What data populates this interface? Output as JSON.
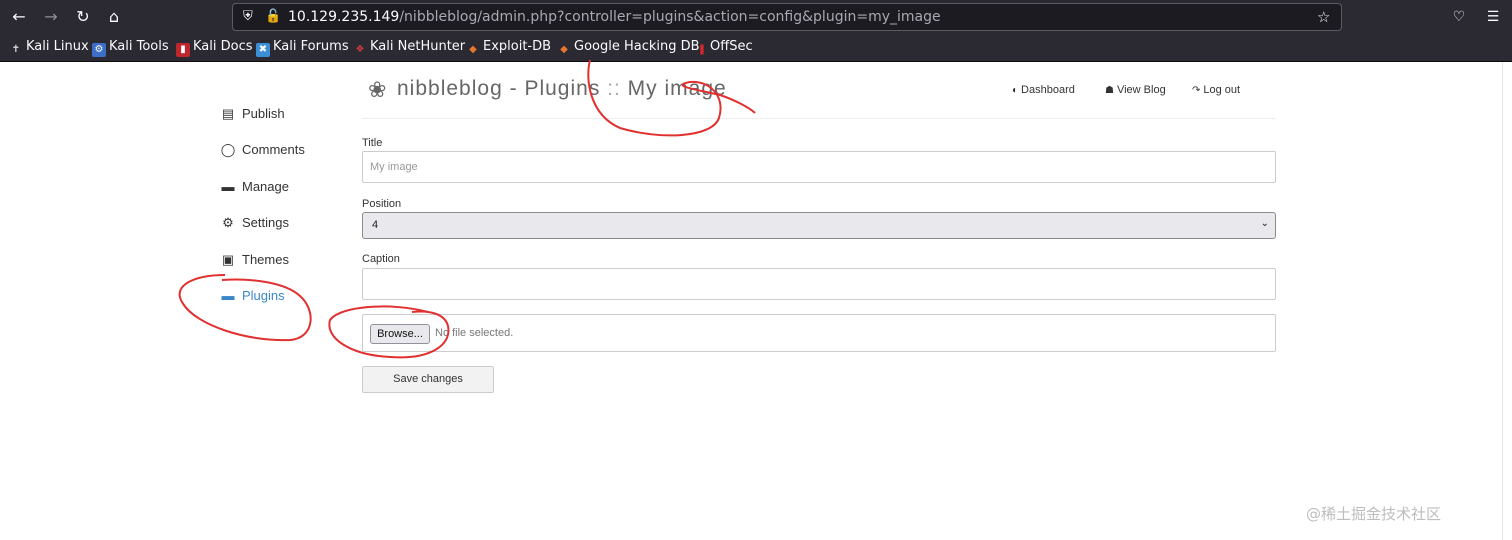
{
  "browser": {
    "url_host": "10.129.235.149",
    "url_path": "/nibbleblog/admin.php?controller=plugins&action=config&plugin=my_image",
    "bookmarks": [
      {
        "label": "Kali Linux",
        "icon": "kali-dragon-icon",
        "color": "#dddddd"
      },
      {
        "label": "Kali Tools",
        "icon": "kali-tools-icon",
        "color": "#3b6ec9"
      },
      {
        "label": "Kali Docs",
        "icon": "kali-docs-icon",
        "color": "#c0262d"
      },
      {
        "label": "Kali Forums",
        "icon": "kali-forums-icon",
        "color": "#3b8fd6"
      },
      {
        "label": "Kali NetHunter",
        "icon": "nethunter-icon",
        "color": "#d23c3c"
      },
      {
        "label": "Exploit-DB",
        "icon": "exploit-db-icon",
        "color": "#e7762d"
      },
      {
        "label": "Google Hacking DB",
        "icon": "ghdb-icon",
        "color": "#e7762d"
      },
      {
        "label": "OffSec",
        "icon": "offsec-icon",
        "color": "#d9262d"
      }
    ]
  },
  "sidebar": {
    "items": [
      {
        "label": "Publish",
        "icon": "publish-icon"
      },
      {
        "label": "Comments",
        "icon": "comment-icon"
      },
      {
        "label": "Manage",
        "icon": "folder-icon"
      },
      {
        "label": "Settings",
        "icon": "gear-icon"
      },
      {
        "label": "Themes",
        "icon": "image-icon"
      },
      {
        "label": "Plugins",
        "icon": "folder-open-icon",
        "active": true
      }
    ]
  },
  "header": {
    "brand": "nibbleblog",
    "dash": " - ",
    "section": "Plugins",
    "sep": " :: ",
    "plugin": "My image",
    "links": [
      {
        "label": "Dashboard",
        "icon": "gauge-icon"
      },
      {
        "label": "View Blog",
        "icon": "home-icon"
      },
      {
        "label": "Log out",
        "icon": "logout-icon"
      }
    ]
  },
  "form": {
    "title_label": "Title",
    "title_value": "My image",
    "position_label": "Position",
    "position_value": "4",
    "caption_label": "Caption",
    "caption_value": "",
    "browse_label": "Browse...",
    "file_status": "No file selected.",
    "save_label": "Save changes"
  },
  "watermark": "@稀土掘金技术社区",
  "colors": {
    "accent": "#3a87c8",
    "annotation": "#e03030",
    "chrome": "#2b2a33"
  }
}
